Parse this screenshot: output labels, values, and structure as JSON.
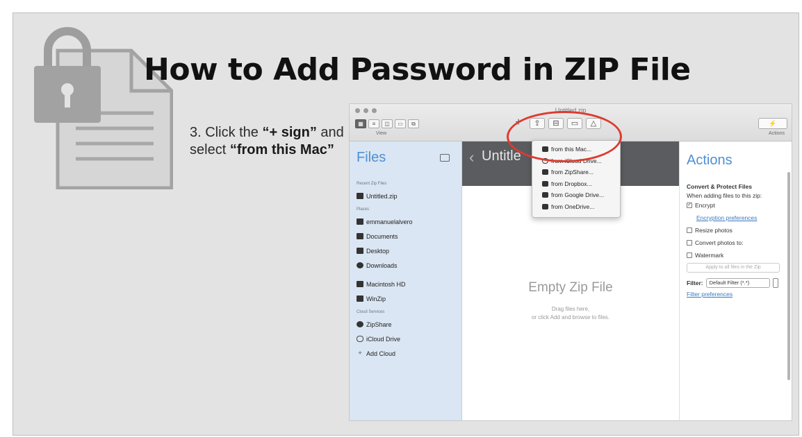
{
  "title": "How to Add Password in ZIP File",
  "instruction": {
    "step_prefix": "3. Click the ",
    "plus_sign": "“+ sign”",
    "middle": " and select ",
    "from_this_mac": "“from this Mac”"
  },
  "window": {
    "title": "Untitled.zip",
    "view_label": "View",
    "actions_label": "Actions",
    "actions_button": "⚡",
    "toolbar_add": "+"
  },
  "sidebar": {
    "title": "Files",
    "recent_heading": "Recent Zip Files",
    "recent": [
      "Untitled.zip"
    ],
    "places_heading": "Places",
    "places": [
      "emmanuelalvero",
      "Documents",
      "Desktop",
      "Downloads"
    ],
    "drives": [
      "Macintosh HD",
      "WinZip"
    ],
    "cloud_heading": "Cloud Services",
    "cloud": [
      "ZipShare",
      "iCloud Drive"
    ],
    "add_cloud": "Add Cloud"
  },
  "center": {
    "back": "‹",
    "name": "Untitle",
    "empty_title": "Empty Zip File",
    "hint_line1": "Drag files here,",
    "hint_line2": "or click Add and browse to files."
  },
  "dropdown": {
    "items": [
      "from this Mac...",
      "from iCloud Drive...",
      "from ZipShare...",
      "from Dropbox...",
      "from Google Drive...",
      "from OneDrive..."
    ]
  },
  "actions": {
    "title": "Actions",
    "section": "Convert & Protect Files",
    "subtitle": "When adding files to this zip:",
    "encrypt": "Encrypt",
    "encryption_prefs": "Encryption preferences",
    "resize": "Resize photos",
    "convert": "Convert photos to:",
    "watermark": "Watermark",
    "apply_all": "Apply to all files in the Zip",
    "filter_label": "Filter:",
    "filter_value": "Default Filter (*.*)",
    "filter_prefs": "Filter preferences"
  },
  "colors": {
    "accent_blue": "#4f8fd3",
    "highlight_red": "#dd3b2f",
    "sidebar_bg": "#dae6f3"
  }
}
